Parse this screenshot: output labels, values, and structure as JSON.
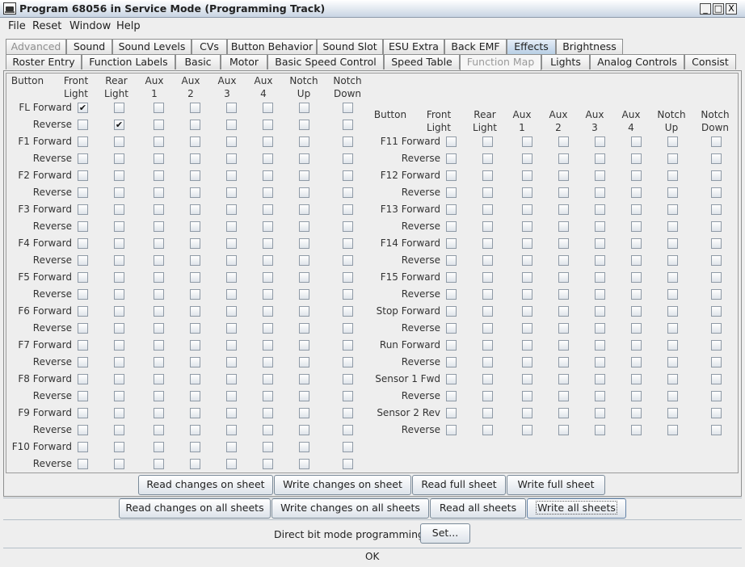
{
  "window": {
    "title": "Program 68056 in Service Mode (Programming Track)",
    "controls": [
      "_",
      "□",
      "X"
    ]
  },
  "menu": [
    "File",
    "Reset",
    "Window",
    "Help"
  ],
  "tabs": {
    "row1": [
      {
        "label": "Advanced",
        "state": "disabled"
      },
      {
        "label": "Sound",
        "state": "normal"
      },
      {
        "label": "Sound Levels",
        "state": "normal"
      },
      {
        "label": "CVs",
        "state": "normal"
      },
      {
        "label": "Button Behavior",
        "state": "normal"
      },
      {
        "label": "Sound Slot",
        "state": "normal"
      },
      {
        "label": "ESU Extra",
        "state": "normal"
      },
      {
        "label": "Back EMF",
        "state": "normal"
      },
      {
        "label": "Effects",
        "state": "highlighted"
      },
      {
        "label": "Brightness",
        "state": "normal"
      }
    ],
    "row2": [
      {
        "label": "Roster Entry",
        "state": "normal"
      },
      {
        "label": "Function Labels",
        "state": "normal"
      },
      {
        "label": "Basic",
        "state": "normal"
      },
      {
        "label": "Motor",
        "state": "normal"
      },
      {
        "label": "Basic Speed Control",
        "state": "normal"
      },
      {
        "label": "Speed Table",
        "state": "normal"
      },
      {
        "label": "Function Map",
        "state": "selected"
      },
      {
        "label": "Lights",
        "state": "normal"
      },
      {
        "label": "Analog Controls",
        "state": "normal"
      },
      {
        "label": "Consist",
        "state": "normal"
      }
    ]
  },
  "function_map": {
    "headers": [
      [
        "Button",
        ""
      ],
      [
        "Front",
        "Light"
      ],
      [
        "Rear",
        "Light"
      ],
      [
        "Aux",
        "1"
      ],
      [
        "Aux",
        "2"
      ],
      [
        "Aux",
        "3"
      ],
      [
        "Aux",
        "4"
      ],
      [
        "Notch",
        "Up"
      ],
      [
        "Notch",
        "Down"
      ]
    ],
    "left_rows": [
      {
        "label": "FL Forward",
        "checks": [
          true,
          false,
          false,
          false,
          false,
          false,
          false,
          false
        ]
      },
      {
        "label": "Reverse",
        "checks": [
          false,
          true,
          false,
          false,
          false,
          false,
          false,
          false
        ]
      },
      {
        "label": "F1 Forward",
        "checks": [
          false,
          false,
          false,
          false,
          false,
          false,
          false,
          false
        ]
      },
      {
        "label": "Reverse",
        "checks": [
          false,
          false,
          false,
          false,
          false,
          false,
          false,
          false
        ]
      },
      {
        "label": "F2 Forward",
        "checks": [
          false,
          false,
          false,
          false,
          false,
          false,
          false,
          false
        ]
      },
      {
        "label": "Reverse",
        "checks": [
          false,
          false,
          false,
          false,
          false,
          false,
          false,
          false
        ]
      },
      {
        "label": "F3 Forward",
        "checks": [
          false,
          false,
          false,
          false,
          false,
          false,
          false,
          false
        ]
      },
      {
        "label": "Reverse",
        "checks": [
          false,
          false,
          false,
          false,
          false,
          false,
          false,
          false
        ]
      },
      {
        "label": "F4 Forward",
        "checks": [
          false,
          false,
          false,
          false,
          false,
          false,
          false,
          false
        ]
      },
      {
        "label": "Reverse",
        "checks": [
          false,
          false,
          false,
          false,
          false,
          false,
          false,
          false
        ]
      },
      {
        "label": "F5 Forward",
        "checks": [
          false,
          false,
          false,
          false,
          false,
          false,
          false,
          false
        ]
      },
      {
        "label": "Reverse",
        "checks": [
          false,
          false,
          false,
          false,
          false,
          false,
          false,
          false
        ]
      },
      {
        "label": "F6 Forward",
        "checks": [
          false,
          false,
          false,
          false,
          false,
          false,
          false,
          false
        ]
      },
      {
        "label": "Reverse",
        "checks": [
          false,
          false,
          false,
          false,
          false,
          false,
          false,
          false
        ]
      },
      {
        "label": "F7 Forward",
        "checks": [
          false,
          false,
          false,
          false,
          false,
          false,
          false,
          false
        ]
      },
      {
        "label": "Reverse",
        "checks": [
          false,
          false,
          false,
          false,
          false,
          false,
          false,
          false
        ]
      },
      {
        "label": "F8 Forward",
        "checks": [
          false,
          false,
          false,
          false,
          false,
          false,
          false,
          false
        ]
      },
      {
        "label": "Reverse",
        "checks": [
          false,
          false,
          false,
          false,
          false,
          false,
          false,
          false
        ]
      },
      {
        "label": "F9 Forward",
        "checks": [
          false,
          false,
          false,
          false,
          false,
          false,
          false,
          false
        ]
      },
      {
        "label": "Reverse",
        "checks": [
          false,
          false,
          false,
          false,
          false,
          false,
          false,
          false
        ]
      },
      {
        "label": "F10 Forward",
        "checks": [
          false,
          false,
          false,
          false,
          false,
          false,
          false,
          false
        ]
      },
      {
        "label": "Reverse",
        "checks": [
          false,
          false,
          false,
          false,
          false,
          false,
          false,
          false
        ]
      }
    ],
    "right_rows": [
      {
        "label": "F11 Forward",
        "checks": [
          false,
          false,
          false,
          false,
          false,
          false,
          false,
          false
        ]
      },
      {
        "label": "Reverse",
        "checks": [
          false,
          false,
          false,
          false,
          false,
          false,
          false,
          false
        ]
      },
      {
        "label": "F12 Forward",
        "checks": [
          false,
          false,
          false,
          false,
          false,
          false,
          false,
          false
        ]
      },
      {
        "label": "Reverse",
        "checks": [
          false,
          false,
          false,
          false,
          false,
          false,
          false,
          false
        ]
      },
      {
        "label": "F13 Forward",
        "checks": [
          false,
          false,
          false,
          false,
          false,
          false,
          false,
          false
        ]
      },
      {
        "label": "Reverse",
        "checks": [
          false,
          false,
          false,
          false,
          false,
          false,
          false,
          false
        ]
      },
      {
        "label": "F14 Forward",
        "checks": [
          false,
          false,
          false,
          false,
          false,
          false,
          false,
          false
        ]
      },
      {
        "label": "Reverse",
        "checks": [
          false,
          false,
          false,
          false,
          false,
          false,
          false,
          false
        ]
      },
      {
        "label": "F15 Forward",
        "checks": [
          false,
          false,
          false,
          false,
          false,
          false,
          false,
          false
        ]
      },
      {
        "label": "Reverse",
        "checks": [
          false,
          false,
          false,
          false,
          false,
          false,
          false,
          false
        ]
      },
      {
        "label": "Stop Forward",
        "checks": [
          false,
          false,
          false,
          false,
          false,
          false,
          false,
          false
        ]
      },
      {
        "label": "Reverse",
        "checks": [
          false,
          false,
          false,
          false,
          false,
          false,
          false,
          false
        ]
      },
      {
        "label": "Run Forward",
        "checks": [
          false,
          false,
          false,
          false,
          false,
          false,
          false,
          false
        ]
      },
      {
        "label": "Reverse",
        "checks": [
          false,
          false,
          false,
          false,
          false,
          false,
          false,
          false
        ]
      },
      {
        "label": "Sensor 1 Fwd",
        "checks": [
          false,
          false,
          false,
          false,
          false,
          false,
          false,
          false
        ]
      },
      {
        "label": "Reverse",
        "checks": [
          false,
          false,
          false,
          false,
          false,
          false,
          false,
          false
        ]
      },
      {
        "label": "Sensor 2 Rev",
        "checks": [
          false,
          false,
          false,
          false,
          false,
          false,
          false,
          false
        ]
      },
      {
        "label": "Reverse",
        "checks": [
          false,
          false,
          false,
          false,
          false,
          false,
          false,
          false
        ]
      }
    ]
  },
  "sheet_buttons": {
    "read_changes_on_sheet": "Read changes on sheet",
    "write_changes_on_sheet": "Write changes on sheet",
    "read_full_sheet": "Read full sheet",
    "write_full_sheet": "Write full sheet"
  },
  "all_buttons": {
    "read_changes_on_all_sheets": "Read changes on all sheets",
    "write_changes_on_all_sheets": "Write changes on all sheets",
    "read_all_sheets": "Read all sheets",
    "write_all_sheets": "Write all sheets"
  },
  "bit_mode": {
    "label": "Direct bit mode programming",
    "set_button": "Set..."
  },
  "status": {
    "text": "OK"
  },
  "colors": {
    "window_bg": "#eeeeee",
    "title_gradient_bottom": "#c8d4e3",
    "highlight_tab": "#b8cfe5",
    "checkbox_border": "#8f9aa6"
  }
}
